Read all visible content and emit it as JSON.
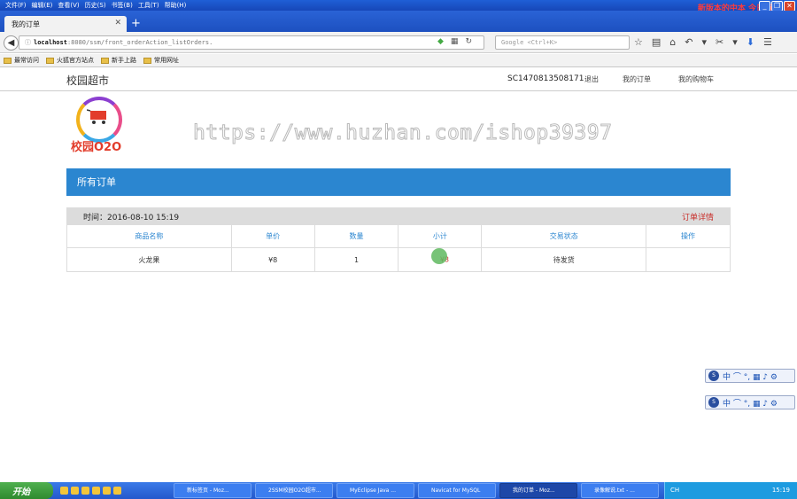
{
  "browser": {
    "menu": [
      "文件(F)",
      "编辑(E)",
      "查看(V)",
      "历史(S)",
      "书签(B)",
      "工具(T)",
      "帮助(H)"
    ],
    "promo_text": "新版本的中本  今日特",
    "tab_title": "我的订单",
    "new_tab_label": "+",
    "url_host": "localhost",
    "url_path": ":8080/ssm/front_orderAction_listOrders.",
    "search_placeholder": "Google <Ctrl+K>",
    "bookmarks": [
      "最常访问",
      "火狐官方站点",
      "新手上路",
      "常用网址"
    ]
  },
  "site": {
    "brand": "校园超市",
    "user_id": "SC1470813508171",
    "logout": "退出",
    "my_orders": "我的订单",
    "my_cart": "我的购物车",
    "logo_text": "校园O2O",
    "watermark": "https://www.huzhan.com/ishop39397"
  },
  "orders": {
    "section_title": "所有订单",
    "time_label": "时间：2016-08-10 15:19",
    "detail_link": "订单详情",
    "columns": [
      "商品名称",
      "单价",
      "数量",
      "小计",
      "交易状态",
      "操作"
    ],
    "rows": [
      {
        "name": "火龙果",
        "price": "¥8",
        "qty": "1",
        "subtotal": "¥8",
        "status": "待发货",
        "action": ""
      }
    ]
  },
  "ime": {
    "logo": "S",
    "icons": "中 ⌒ °, ▦ ♪ ⚙"
  },
  "taskbar": {
    "start": "开始",
    "buttons": [
      "新标签页 - Moz...",
      "2SSM校园O2O超市...",
      "MyEclipse Java ...",
      "Navicat for MySQL",
      "我的订单 - Moz...",
      "录像解说.txt - ..."
    ],
    "tray_ime": "CH",
    "clock": "15:19"
  }
}
